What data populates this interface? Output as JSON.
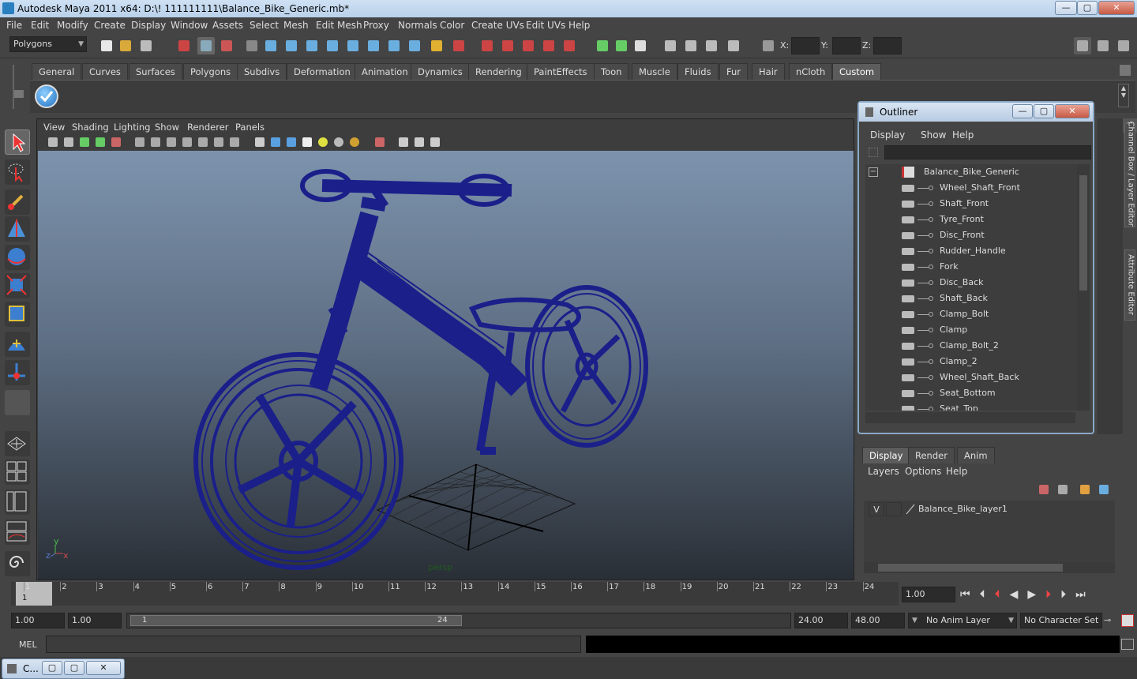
{
  "window": {
    "title": "Autodesk Maya 2011 x64: D:\\! 111111111\\Balance_Bike_Generic.mb*",
    "min": "—",
    "max": "▢",
    "close": "✕"
  },
  "menubar": [
    "File",
    "Edit",
    "Modify",
    "Create",
    "Display",
    "Window",
    "Assets",
    "Select",
    "Mesh",
    "Edit Mesh",
    "Proxy",
    "Normals",
    "Color",
    "Create UVs",
    "Edit UVs",
    "Help"
  ],
  "statusline": {
    "mode": "Polygons",
    "x_label": "X:",
    "y_label": "Y:",
    "z_label": "Z:"
  },
  "shelf": {
    "tabs": [
      "General",
      "Curves",
      "Surfaces",
      "Polygons",
      "Subdivs",
      "Deformation",
      "Animation",
      "Dynamics",
      "Rendering",
      "PaintEffects",
      "Toon",
      "Muscle",
      "Fluids",
      "Fur",
      "Hair",
      "nCloth",
      "Custom"
    ],
    "active": "Custom"
  },
  "viewport": {
    "menu": [
      "View",
      "Shading",
      "Lighting",
      "Show",
      "Renderer",
      "Panels"
    ],
    "camera_label": "persp",
    "axis_y": "y",
    "axis_z": "z",
    "axis_x": "x"
  },
  "outliner": {
    "title": "Outliner",
    "menu": [
      "Display",
      "Show",
      "Help"
    ],
    "root": "Balance_Bike_Generic",
    "children": [
      "Wheel_Shaft_Front",
      "Shaft_Front",
      "Tyre_Front",
      "Disc_Front",
      "Rudder_Handle",
      "Fork",
      "Disc_Back",
      "Shaft_Back",
      "Clamp_Bolt",
      "Clamp",
      "Clamp_Bolt_2",
      "Clamp_2",
      "Wheel_Shaft_Back",
      "Seat_Bottom",
      "Seat_Top"
    ],
    "collapse": "−"
  },
  "side_tabs": {
    "channel_box": "Channel Box / Layer Editor",
    "attribute_editor": "Attribute Editor"
  },
  "layers": {
    "tabs": [
      "Display",
      "Render",
      "Anim"
    ],
    "menu": [
      "Layers",
      "Options",
      "Help"
    ],
    "visible_flag": "V",
    "layer_name": "Balance_Bike_layer1"
  },
  "timeline": {
    "ticks": [
      "1",
      "2",
      "3",
      "4",
      "5",
      "6",
      "7",
      "8",
      "9",
      "10",
      "11",
      "12",
      "13",
      "14",
      "15",
      "16",
      "17",
      "18",
      "19",
      "20",
      "21",
      "22",
      "23",
      "24"
    ],
    "current_frame_marker": "1",
    "current_time": "1.00"
  },
  "range": {
    "start": "1.00",
    "playback_start": "1.00",
    "slider_start": "1",
    "slider_end": "24",
    "playback_end": "24.00",
    "end": "48.00",
    "anim_layer": "No Anim Layer",
    "character_set": "No Character Set"
  },
  "command": {
    "label": "MEL"
  },
  "taskbar": {
    "item": "C..."
  },
  "colors": {
    "wireframe": "#1a1f8a",
    "accent": "#5c5c5c",
    "title_gradient": "#b9d1ea"
  }
}
